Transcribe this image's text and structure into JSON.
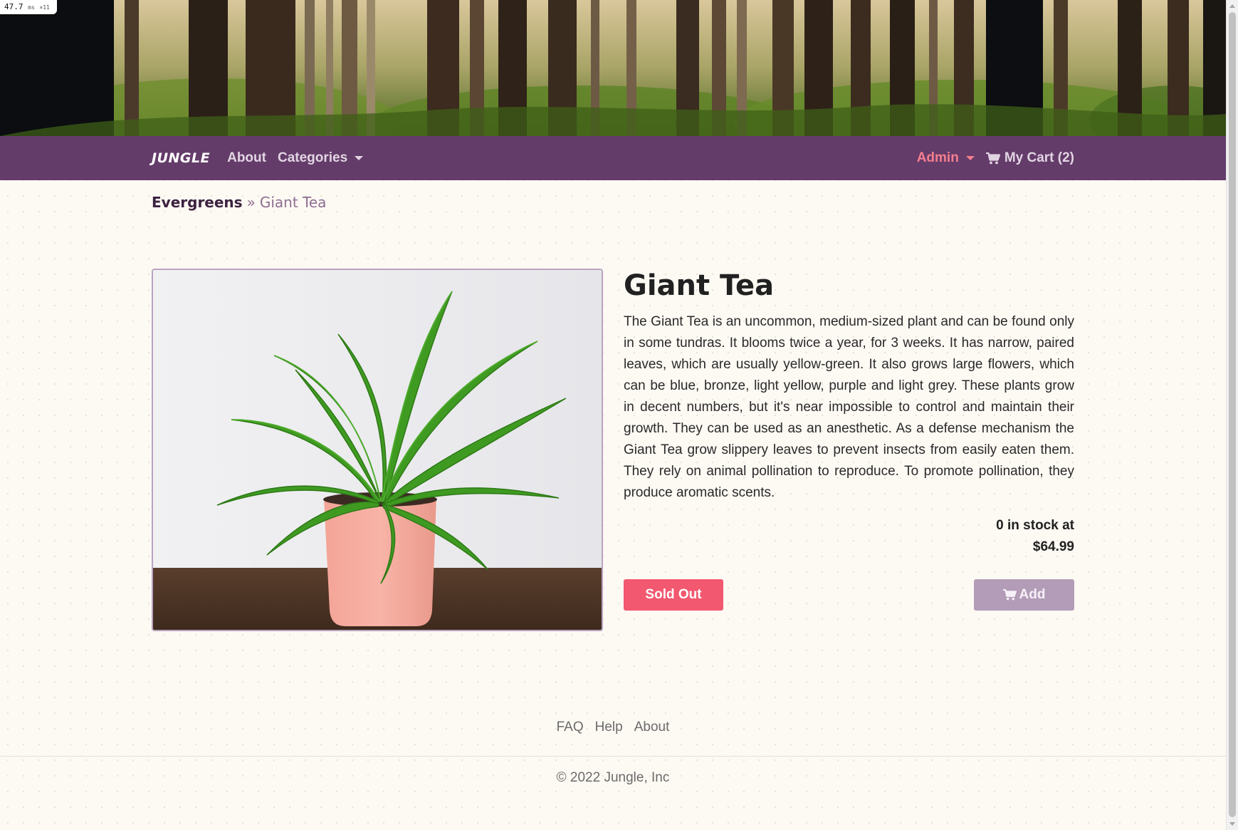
{
  "perf": {
    "value": "47.7",
    "unit": "ms",
    "mult": "×11"
  },
  "header": {
    "hero_image": "forest-banner"
  },
  "navbar": {
    "brand": "JUNGLE",
    "about": "About",
    "categories": "Categories",
    "admin": "Admin",
    "cart": "My Cart (2)",
    "background_color": "#643c6a"
  },
  "breadcrumb": {
    "category": "Evergreens",
    "separator": "»",
    "current": "Giant Tea"
  },
  "product": {
    "image": "potted-fern-plant",
    "name": "Giant Tea",
    "description": "The Giant Tea is an uncommon, medium-sized plant and can be found only in some tundras. It blooms twice a year, for 3 weeks. It has narrow, paired leaves, which are usually yellow-green. It also grows large flowers, which can be blue, bronze, light yellow, purple and light grey. These plants grow in decent numbers, but it's near impossible to control and maintain their growth. They can be used as an anesthetic. As a defense mechanism the Giant Tea grow slippery leaves to prevent insects from easily eaten them. They rely on animal pollination to reproduce. To promote pollination, they produce aromatic scents.",
    "stock_line": "0 in stock at",
    "price": "$64.99",
    "sold_out_label": "Sold Out",
    "add_label": "Add",
    "sold_out_color": "#f2586f",
    "add_color": "#b39cb8"
  },
  "footer": {
    "links": [
      "FAQ",
      "Help",
      "About"
    ],
    "copyright": "© 2022 Jungle, Inc"
  }
}
